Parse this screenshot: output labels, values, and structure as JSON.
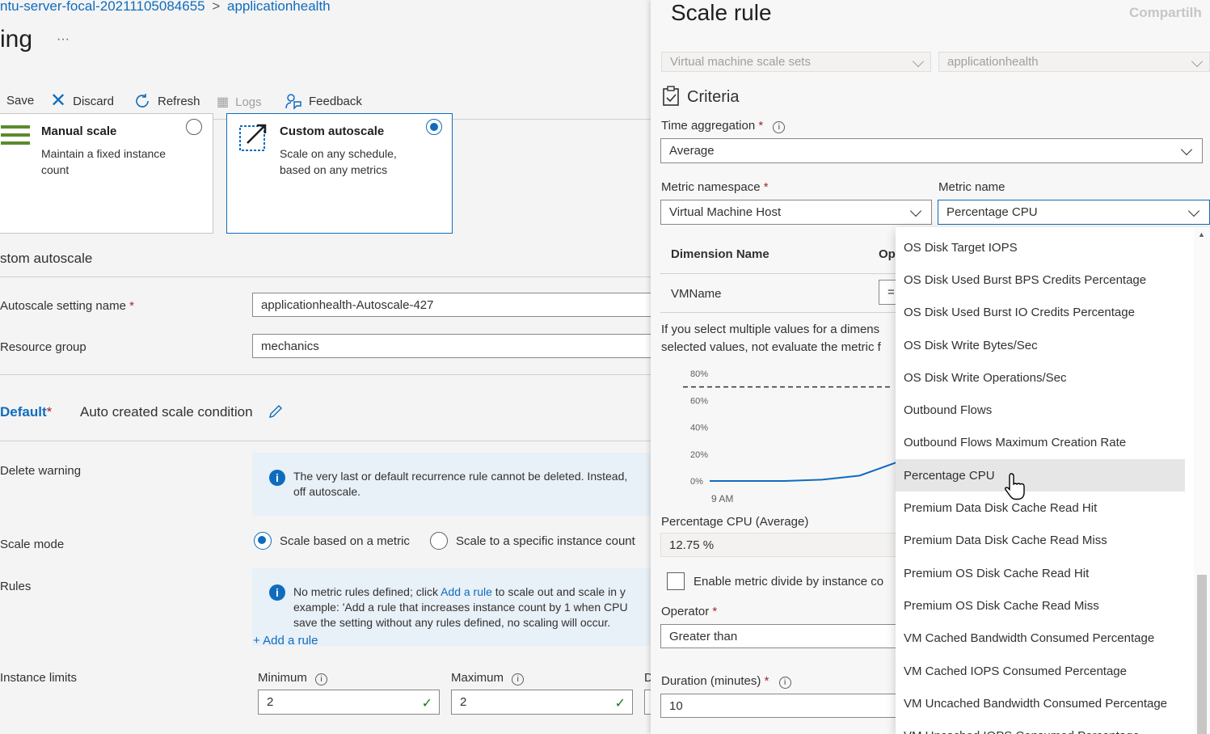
{
  "breadcrumb": {
    "vm": "ntu-server-focal-20211105084655",
    "separator": ">",
    "current": "applicationhealth"
  },
  "page_title": "ing",
  "more": "···",
  "toolbar": {
    "save": "Save",
    "discard": "Discard",
    "refresh": "Refresh",
    "logs": "Logs",
    "feedback": "Feedback"
  },
  "mode_cards": {
    "manual": {
      "title": "Manual scale",
      "desc1": "Maintain a fixed instance",
      "desc2": "count",
      "selected": false
    },
    "custom": {
      "title": "Custom autoscale",
      "desc1": "Scale on any schedule,",
      "desc2": "based on any metrics",
      "selected": true
    }
  },
  "section_title": "stom autoscale",
  "form": {
    "setting_name_label": "Autoscale setting name",
    "setting_name_value": "applicationhealth-Autoscale-427",
    "resource_group_label": "Resource group",
    "resource_group_value": "mechanics",
    "required": "*"
  },
  "condition": {
    "name": "Default",
    "required": "*",
    "desc": "Auto created scale condition"
  },
  "delete_warning": {
    "label": "Delete warning",
    "line1": "The very last or default recurrence rule cannot be deleted. Instead,",
    "line2": "off autoscale."
  },
  "scale_mode": {
    "label": "Scale mode",
    "option1": "Scale based on a metric",
    "option2": "Scale to a specific instance count",
    "selected": "option1"
  },
  "rules": {
    "label": "Rules",
    "line1_pre": "No metric rules defined; click ",
    "line1_link": "Add a rule",
    "line1_post": " to scale out and scale in y",
    "line2": "example: 'Add a rule that increases instance count by 1 when CPU",
    "line3": "save the setting without any rules defined, no scaling will occur.",
    "add_rule": "+ Add a rule"
  },
  "instance_limits": {
    "label": "Instance limits",
    "minimum_label": "Minimum",
    "minimum_value": "2",
    "maximum_label": "Maximum",
    "maximum_value": "2",
    "default_label_partial": "D"
  },
  "panel": {
    "title": "Scale rule",
    "top_right": "Compartilh",
    "source_type": "Virtual machine scale sets",
    "source_resource": "applicationhealth",
    "criteria": "Criteria",
    "time_aggregation_label": "Time aggregation",
    "time_aggregation_value": "Average",
    "metric_namespace_label": "Metric namespace",
    "metric_namespace_value": "Virtual Machine Host",
    "metric_name_label": "Metric name",
    "metric_name_value": "Percentage CPU",
    "dimension_name_header": "Dimension Name",
    "operator_header_partial": "Op",
    "dimension_row": "VMName",
    "dimension_op_partial": "=",
    "note_line1": "If you select multiple values for a dimens",
    "note_line2": "selected values, not evaluate the metric f",
    "metric_value_label": "Percentage CPU (Average)",
    "metric_value": "12.75 %",
    "enable_divide": "Enable metric divide by instance co",
    "operator_label": "Operator",
    "operator_value": "Greater than",
    "duration_label": "Duration (minutes)",
    "duration_value": "10",
    "required": "*"
  },
  "chart_data": {
    "type": "line",
    "ylabels": [
      "80%",
      "60%",
      "40%",
      "20%",
      "0%"
    ],
    "x_tick": "9 AM",
    "threshold_percent": 70,
    "series": [
      {
        "values": [
          0,
          0,
          0,
          1,
          4,
          14
        ]
      }
    ],
    "ylim": [
      0,
      80
    ],
    "colors": {
      "line": "#0f6cbd",
      "threshold": "#323130"
    }
  },
  "dropdown_options": [
    "OS Disk Target IOPS",
    "OS Disk Used Burst BPS Credits Percentage",
    "OS Disk Used Burst IO Credits Percentage",
    "OS Disk Write Bytes/Sec",
    "OS Disk Write Operations/Sec",
    "Outbound Flows",
    "Outbound Flows Maximum Creation Rate",
    "Percentage CPU",
    "Premium Data Disk Cache Read Hit",
    "Premium Data Disk Cache Read Miss",
    "Premium OS Disk Cache Read Hit",
    "Premium OS Disk Cache Read Miss",
    "VM Cached Bandwidth Consumed Percentage",
    "VM Cached IOPS Consumed Percentage",
    "VM Uncached Bandwidth Consumed Percentage",
    "VM Uncached IOPS Consumed Percentage"
  ],
  "dropdown_selected": "Percentage CPU",
  "colors": {
    "accent": "#0f6cbd",
    "valid": "#107c10",
    "required": "#a4262c"
  }
}
